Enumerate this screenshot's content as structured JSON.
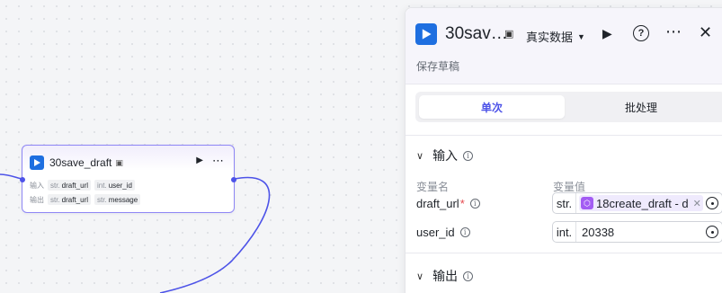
{
  "node": {
    "title": "30save_draft",
    "input_label": "输入",
    "output_label": "输出",
    "inputs": [
      {
        "type": "str.",
        "name": "draft_url"
      },
      {
        "type": "int.",
        "name": "user_id"
      }
    ],
    "outputs": [
      {
        "type": "str.",
        "name": "draft_url"
      },
      {
        "type": "str.",
        "name": "message"
      }
    ]
  },
  "panel": {
    "title": "30sav…",
    "data_mode": "真实数据",
    "description": "保存草稿",
    "tabs": [
      {
        "label": "单次",
        "active": true
      },
      {
        "label": "批处理",
        "active": false
      }
    ],
    "input_section": "输入",
    "output_section": "输出",
    "col_name": "变量名",
    "col_value": "变量值",
    "params": [
      {
        "name": "draft_url",
        "required": true,
        "type": "str.",
        "reference": "18create_draft - d"
      },
      {
        "name": "user_id",
        "required": false,
        "type": "int.",
        "value": "20338"
      }
    ]
  },
  "icons": {
    "app_logo": "play-logo-icon",
    "data_mode_icon": "database-icon",
    "run": "play-icon",
    "help": "help-icon",
    "more": "more-icon",
    "close": "close-icon"
  },
  "colors": {
    "accent": "#4d53e8",
    "logo": "#1e6fe0",
    "reference_chip": "#a35cf3",
    "required": "#e5484d"
  }
}
